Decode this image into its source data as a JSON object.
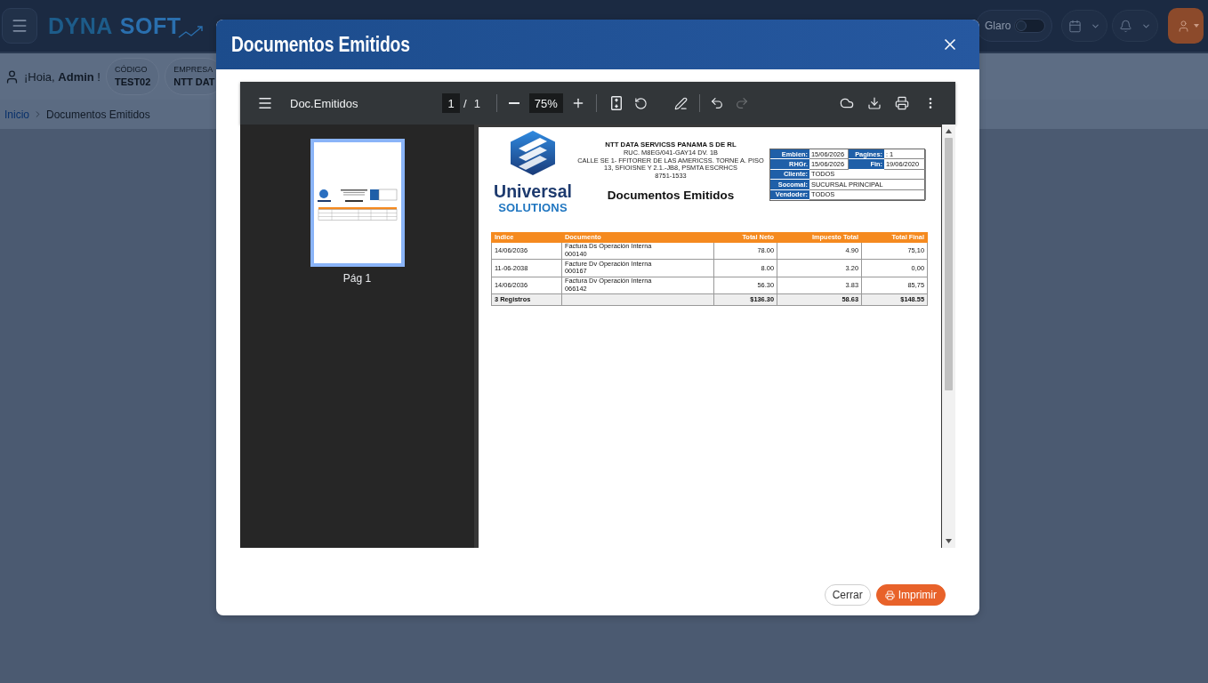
{
  "app_header": {
    "logo": {
      "words": [
        "DYNA",
        "SOFT"
      ]
    },
    "theme_toggle": {
      "label": "Glaro",
      "on": false
    }
  },
  "user_bar": {
    "greeting": "¡Hoia, **Admin** !",
    "chips": [
      {
        "label": "CÓDIGO",
        "value": "TEST02"
      },
      {
        "label": "EMPRESA",
        "value": "NTT DAT"
      }
    ]
  },
  "breadcrumb": [
    {
      "label": "Inicio",
      "kind": "link"
    },
    {
      "label": "Documentos Emitidos",
      "kind": "current"
    }
  ],
  "modal": {
    "title": "Documentos Emitidos",
    "pdf_viewer": {
      "toolbar": {
        "title": "Doc.Emitidos",
        "page_input": "1",
        "page_separator": "/",
        "page_total": "1",
        "zoom": "75%",
        "undo": {
          "disabled": false
        },
        "redo": {
          "disabled": true
        }
      },
      "thumbnails": [
        {
          "label": "Pág 1",
          "selected": true
        }
      ],
      "page": {
        "logo": {
          "name": "Universal",
          "tagline": "SOLUTIONS"
        },
        "company": {
          "name": "NTT DATA SERVICSS PANAMA S DE RL",
          "lines": [
            "RUC. M8EG/041-GAY14 DV. 1B",
            "CALLE SE 1- FFITORER DE LAS AMERICSS. TORNE A. PISO",
            "13, SFIOISNE Y 2.1.-JB8, PSMTA ESCRHCS",
            "8751-1533"
          ]
        },
        "title": "Documentos Emitidos",
        "info": [
          {
            "cells": [
              {
                "label": "Embien:",
                "value": "15/06/2026"
              },
              {
                "label": "Pagines:",
                "value": ": 1"
              }
            ]
          },
          {
            "cells": [
              {
                "label": "RHGr.",
                "value": "15/06/2026"
              },
              {
                "label": "Fin:",
                "value": "19/06/2020"
              }
            ]
          },
          {
            "cells": [
              {
                "label": "Cliente:",
                "value": "TODOS"
              }
            ]
          },
          {
            "cells": [
              {
                "label": "Socomal:",
                "value": "SUCURSAL PRINCIPAL"
              }
            ]
          },
          {
            "cells": [
              {
                "label": "Vendoder:",
                "value": "TODOS"
              }
            ]
          }
        ],
        "table": {
          "columns": [
            "Indice",
            "Documento",
            "Total Neto",
            "Impuesto Total",
            "Total Final"
          ],
          "rows": [
            {
              "date": "14/06/2036",
              "document": "Factura Ds Operación Interna",
              "number": "000140",
              "net": "78.00",
              "tax": "4.90",
              "total": "75,10"
            },
            {
              "date": "11-06-2038",
              "document": "Facture Dv Operación Interna",
              "number": "000167",
              "net": "8.00",
              "tax": "3.20",
              "total": "0,00"
            },
            {
              "date": "14/06/2036",
              "document": "Factura Dv Operación Interna",
              "number": "066142",
              "net": "56.30",
              "tax": "3.83",
              "total": "85,75"
            }
          ],
          "footer": {
            "label": "3 Registros",
            "net": "$136.30",
            "tax": "58.63",
            "total": "$148.55"
          }
        }
      }
    },
    "buttons": [
      {
        "label": "Cerrar",
        "kind": "secondary"
      },
      {
        "label": "Imprimir",
        "kind": "primary"
      }
    ]
  }
}
